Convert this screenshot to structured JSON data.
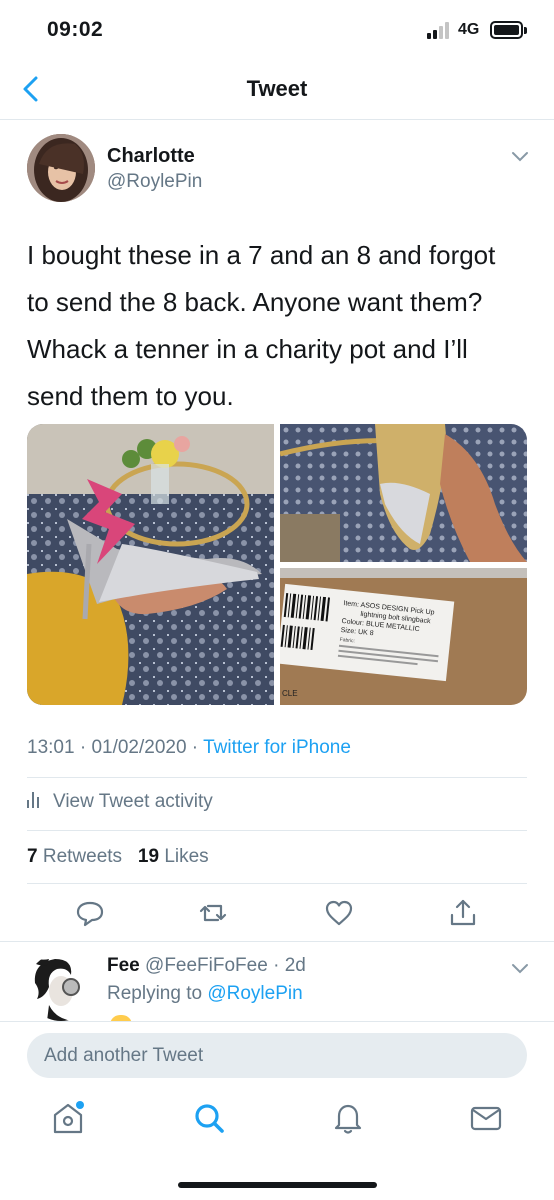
{
  "status_bar": {
    "time": "09:02",
    "network": "4G"
  },
  "nav": {
    "title": "Tweet"
  },
  "tweet": {
    "author_name": "Charlotte",
    "author_handle": "@RoylePin",
    "text_lines": [
      "I bought these in a 7 and an 8 and forgot",
      "to send the 8 back. Anyone want them?",
      "Whack a tenner in a charity pot and I’ll",
      "send them to you."
    ],
    "label_item_prefix": "Item:",
    "label_item": "ASOS DESIGN Pick Up",
    "label_item_2": "lightning bolt slingback",
    "label_colour_prefix": "Colour:",
    "label_colour": "BLUE METALLIC",
    "label_size_prefix": "Size:",
    "label_size": "UK 8",
    "label_fabric": "Fabric:",
    "label_corner": "CLE",
    "time": "13:01",
    "date": "01/02/2020",
    "source": "Twitter for iPhone",
    "activity_label": "View Tweet activity",
    "retweets_count": "7",
    "retweets_label": "Retweets",
    "likes_count": "19",
    "likes_label": "Likes"
  },
  "reply": {
    "name": "Fee",
    "handle": "@FeeFiFoFee",
    "age": "2d",
    "replying_prefix": "Replying to",
    "replying_to": "@RoylePin"
  },
  "compose": {
    "placeholder": "Add another Tweet"
  },
  "colors": {
    "accent": "#1da1f2",
    "text": "#14171a",
    "secondary": "#657786",
    "divider": "#e1e8ed"
  }
}
